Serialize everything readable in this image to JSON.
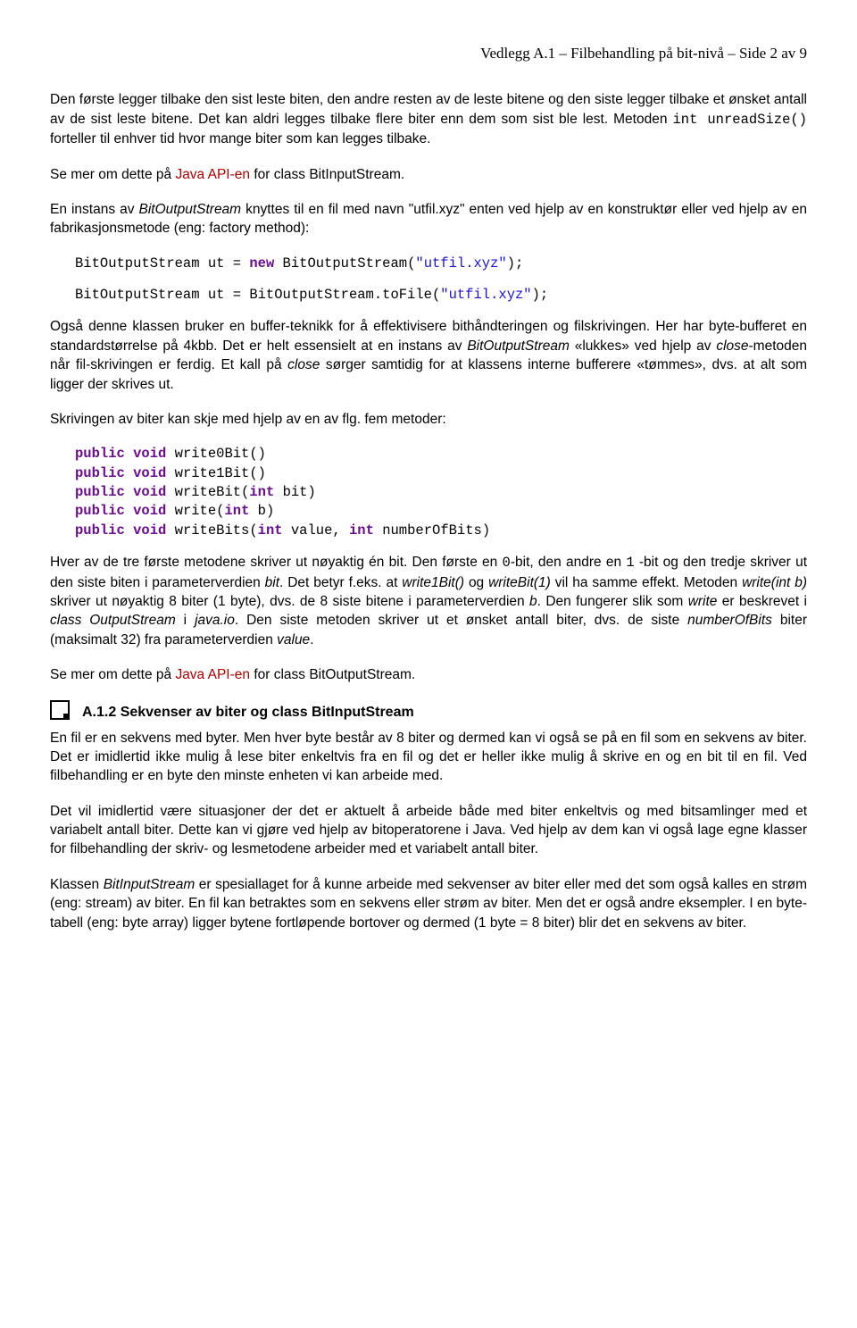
{
  "header": "Vedlegg A.1 – Filbehandling på bit-nivå – Side 2 av 9",
  "p1a": "Den første legger tilbake den sist leste biten, den andre resten av de leste bitene og den siste legger tilbake et ønsket antall av de sist leste bitene. Det kan aldri legges tilbake flere biter enn dem som sist ble lest. Metoden ",
  "p1b": "int unreadSize()",
  "p1c": " forteller til enhver tid hvor mange biter som kan legges tilbake.",
  "p2a": "Se mer om dette på ",
  "p2link": "Java API-en",
  "p2b": " for class BitInputStream.",
  "p3a": "En instans av ",
  "p3b": "BitOutputStream",
  "p3c": " knyttes til en fil med navn \"utfil.xyz\" enten ved hjelp av en konstruktør eller ved hjelp av en fabrikasjonsmetode (eng: factory method):",
  "c1a": "BitOutputStream ut = ",
  "c1kw": "new",
  "c1b": " BitOutputStream(",
  "c1str": "\"utfil.xyz\"",
  "c1c": ");",
  "c2a": "BitOutputStream ut = BitOutputStream.toFile(",
  "c2str": "\"utfil.xyz\"",
  "c2b": ");",
  "p4a": "Også denne klassen bruker en buffer-teknikk for å effektivisere bithåndteringen og filskrivingen. Her har byte-bufferet en standardstørrelse på 4kbb. Det er helt essensielt at en instans av ",
  "p4b": "BitOutputStream",
  "p4c": " «lukkes» ved hjelp av ",
  "p4d": "close",
  "p4e": "-metoden når fil-skrivingen er ferdig. Et kall på ",
  "p4f": "close",
  "p4g": " sørger samtidig for at klassens interne bufferere «tømmes», dvs. at alt som ligger der skrives ut.",
  "p5": "Skrivingen av biter kan skje med hjelp av en av flg. fem metoder:",
  "m": {
    "pub": "public",
    "vd": "void",
    "it": "int",
    "l1": " write0Bit()",
    "l2": " write1Bit()",
    "l3a": " writeBit(",
    "l3b": " bit)",
    "l4a": " write(",
    "l4b": " b)",
    "l5a": " writeBits(",
    "l5b": " value, ",
    "l5c": " numberOfBits)"
  },
  "p6a": "Hver av de tre første metodene skriver ut nøyaktig én bit. Den første en ",
  "p6b": "0",
  "p6c": "-bit, den andre en ",
  "p6d": "1",
  "p6e": "\n-bit og den tredje skriver ut den siste biten i parameterverdien ",
  "p6f": "bit",
  "p6g": ". Det betyr f.eks. at ",
  "p6h": "write1Bit()",
  "p6i": " og ",
  "p6j": "writeBit(1)",
  "p6k": " vil ha samme effekt. Metoden ",
  "p6l": "write(int b)",
  "p6m": " skriver ut nøyaktig 8 biter (1 byte), dvs. de 8 siste bitene i parameterverdien ",
  "p6n": "b",
  "p6o": ". Den fungerer slik som ",
  "p6p": "write",
  "p6q": " er beskrevet i ",
  "p6r": "class OutputStream",
  "p6s": " i ",
  "p6t": " java.io",
  "p6u": ". Den siste metoden skriver ut et ønsket antall biter, dvs. de siste ",
  "p6v": "numberOfBits",
  "p6w": " biter (maksimalt 32) fra parameterverdien ",
  "p6x": "value",
  "p6y": ".",
  "p7a": "Se mer om dette på ",
  "p7link": "Java API-en",
  "p7b": " for class BitOutputStream.",
  "h2": "A.1.2  Sekvenser av biter og class BitInputStream",
  "p8": "En fil er en sekvens med byter. Men hver byte består av 8 biter og dermed kan vi også se på en fil som en sekvens av biter. Det er imidlertid ikke mulig å lese biter enkeltvis fra en fil og det er heller ikke mulig å skrive en og en bit til en fil. Ved filbehandling er en byte den minste enheten vi kan arbeide med.",
  "p9": "Det vil imidlertid være situasjoner der det er aktuelt å arbeide både med biter enkeltvis og med bitsamlinger med et variabelt antall biter. Dette kan vi gjøre ved hjelp av bitoperatorene i Java. Ved hjelp av dem kan vi også lage egne klasser for filbehandling der skriv- og lesmetodene arbeider med et variabelt antall biter.",
  "p10a": "Klassen ",
  "p10b": "BitInputStream",
  "p10c": " er spesiallaget for å kunne arbeide med sekvenser av biter eller med det som også kalles en strøm (eng: stream) av biter. En fil kan betraktes som en sekvens eller strøm av biter. Men det er også andre eksempler. I en byte-tabell (eng: byte array) ligger bytene fortløpende bortover og dermed (1 byte = 8 biter) blir det en sekvens av biter."
}
